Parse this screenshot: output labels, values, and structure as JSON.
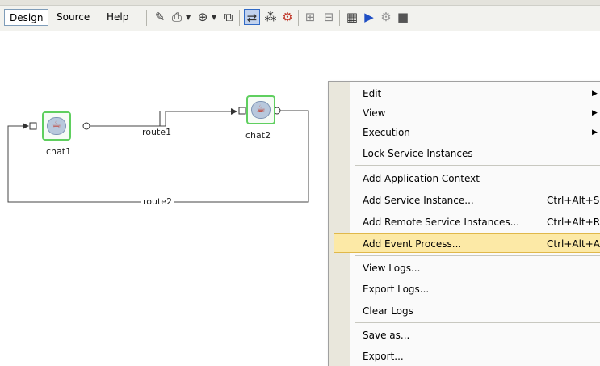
{
  "toolbar": {
    "tabs": [
      {
        "label": "Design",
        "active": true
      },
      {
        "label": "Source",
        "active": false
      },
      {
        "label": "Help",
        "active": false
      }
    ],
    "icons": [
      "pencil-icon",
      "print-icon",
      "zoom-in-icon",
      "fit-page-icon",
      "layout-xyz-icon",
      "layout-tree-icon",
      "debug-icon",
      "grid-icon",
      "grid2-icon",
      "calendar-icon",
      "run-icon",
      "deploy-icon",
      "stop-icon"
    ]
  },
  "diagram": {
    "nodes": [
      {
        "id": "chat1",
        "label": "chat1"
      },
      {
        "id": "chat2",
        "label": "chat2"
      }
    ],
    "routes": [
      {
        "label": "route1",
        "from": "chat1",
        "to": "chat2"
      },
      {
        "label": "route2",
        "from": "chat2",
        "to": "chat1"
      }
    ]
  },
  "menu": {
    "items": [
      {
        "label": "Edit",
        "shortcut": "",
        "submenu": true
      },
      {
        "label": "View",
        "shortcut": "",
        "submenu": true
      },
      {
        "label": "Execution",
        "shortcut": "",
        "submenu": true
      },
      {
        "label": "Lock Service Instances",
        "shortcut": ""
      },
      {
        "label": "Add Application Context",
        "shortcut": ""
      },
      {
        "label": "Add Service Instance...",
        "shortcut": "Ctrl+Alt+S"
      },
      {
        "label": "Add Remote Service Instances...",
        "shortcut": "Ctrl+Alt+R"
      },
      {
        "label": "Add Event Process...",
        "shortcut": "Ctrl+Alt+A",
        "highlighted": true
      },
      {
        "label": "View Logs...",
        "shortcut": ""
      },
      {
        "label": "Export Logs...",
        "shortcut": ""
      },
      {
        "label": "Clear Logs",
        "shortcut": ""
      },
      {
        "label": "Save as...",
        "shortcut": ""
      },
      {
        "label": "Export...",
        "shortcut": ""
      }
    ]
  },
  "colors": {
    "highlight": "#fce9a6",
    "node_border": "#5fcf5f",
    "toolbar_bg": "#f2f2ee"
  }
}
